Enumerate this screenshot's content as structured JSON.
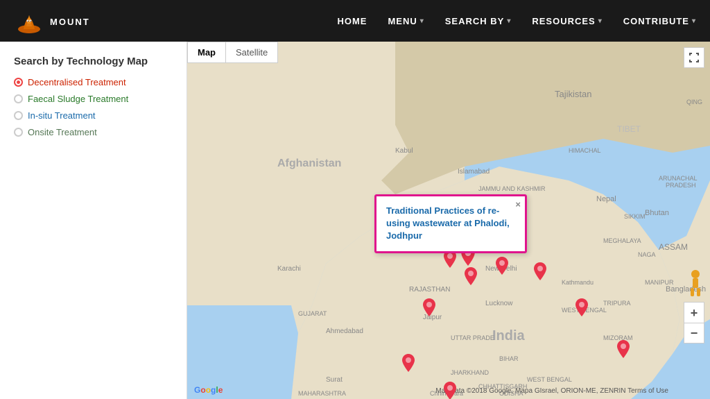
{
  "header": {
    "logo_text": "MOUNT",
    "nav_items": [
      {
        "label": "HOME",
        "has_dropdown": false
      },
      {
        "label": "MENU",
        "has_dropdown": true
      },
      {
        "label": "SEARCH BY",
        "has_dropdown": true
      },
      {
        "label": "RESOURCES",
        "has_dropdown": true
      },
      {
        "label": "CONTRIBUTE",
        "has_dropdown": true
      }
    ]
  },
  "sidebar": {
    "title": "Search by Technology Map",
    "filters": [
      {
        "label": "Decentralised Treatment",
        "color": "red",
        "active": true
      },
      {
        "label": "Faecal Sludge Treatment",
        "color": "green",
        "active": false
      },
      {
        "label": "In-situ Treatment",
        "color": "blue",
        "active": false
      },
      {
        "label": "Onsite Treatment",
        "color": "gray",
        "active": false
      }
    ]
  },
  "map": {
    "tab_map": "Map",
    "tab_satellite": "Satellite",
    "active_tab": "Map",
    "popup_title": "Traditional Practices of re-using wastewater at Phalodi, Jodhpur",
    "popup_close": "×",
    "fullscreen_icon": "⛶",
    "zoom_in": "+",
    "zoom_out": "−",
    "pegman": "🚶",
    "google_text": "Google",
    "attribution": "Map data ©2018 Google, Mapa GIsrael, ORION-ME, ZENRIN  Terms of Use"
  }
}
